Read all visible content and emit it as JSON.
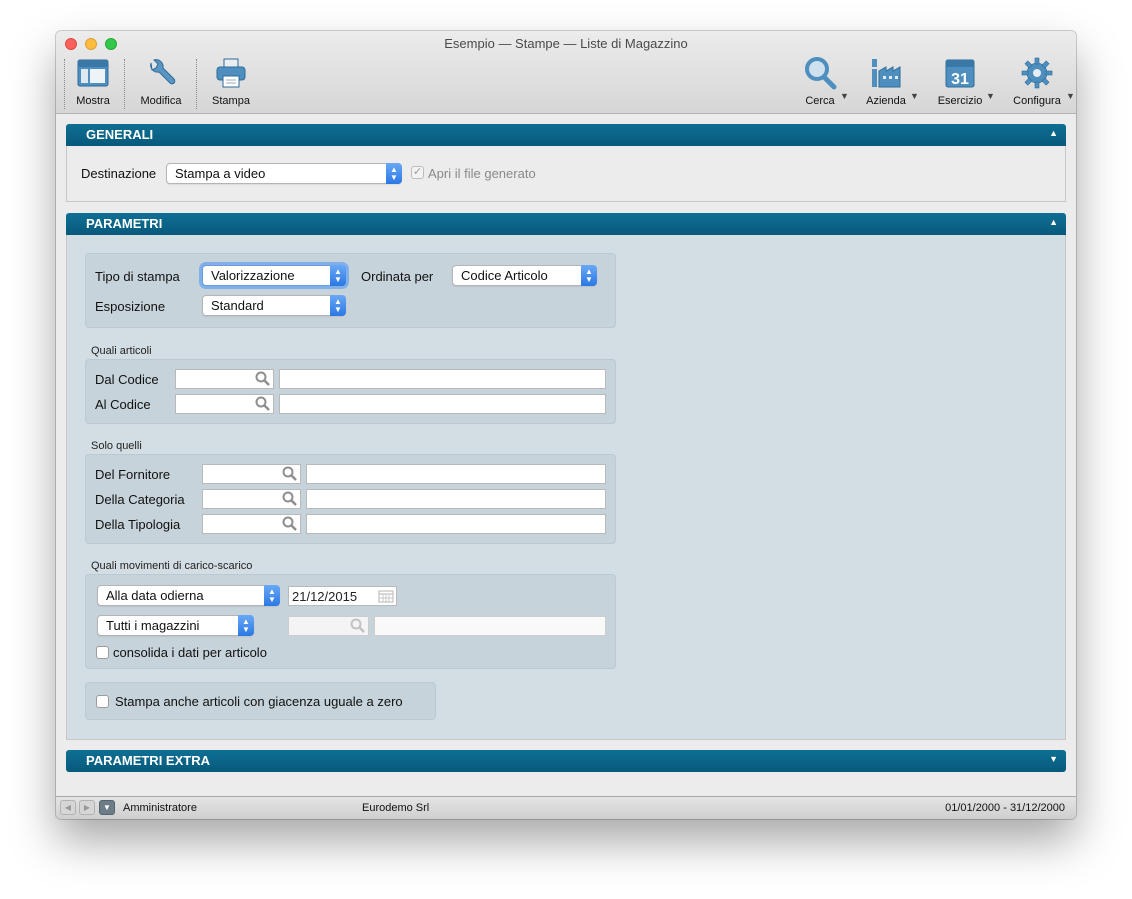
{
  "window": {
    "title": "Esempio — Stampe — Liste di Magazzino"
  },
  "toolbar": {
    "mostra": "Mostra",
    "modifica": "Modifica",
    "stampa": "Stampa",
    "cerca": "Cerca",
    "azienda": "Azienda",
    "esercizio": "Esercizio",
    "esercizio_icon_day": "31",
    "configura": "Configura",
    "icons": [
      "layout-icon",
      "wrench-icon",
      "printer-icon",
      "magnifier-icon",
      "factory-icon",
      "calendar-icon",
      "gear-icon"
    ]
  },
  "generali": {
    "header": "GENERALI",
    "destinazione_label": "Destinazione",
    "destinazione_value": "Stampa a video",
    "apri_file_label": "Apri il file generato",
    "apri_file_checked": true
  },
  "parametri": {
    "header": "PARAMETRI",
    "tipo_stampa_label": "Tipo di stampa",
    "tipo_stampa_value": "Valorizzazione",
    "ordinata_per_label": "Ordinata per",
    "ordinata_per_value": "Codice Articolo",
    "esposizione_label": "Esposizione",
    "esposizione_value": "Standard",
    "quali_articoli": {
      "title": "Quali articoli",
      "dal_codice_label": "Dal Codice",
      "al_codice_label": "Al Codice",
      "dal_codice_value": "",
      "al_codice_value": ""
    },
    "solo_quelli": {
      "title": "Solo quelli",
      "fornitore_label": "Del Fornitore",
      "categoria_label": "Della Categoria",
      "tipologia_label": "Della Tipologia"
    },
    "movimenti": {
      "title": "Quali movimenti di carico-scarico",
      "data_mode": "Alla data odierna",
      "data_value": "21/12/2015",
      "magazzini": "Tutti i magazzini",
      "consolida_label": "consolida i dati per articolo",
      "consolida_checked": false
    },
    "giacenza_zero_label": "Stampa anche articoli con giacenza uguale a zero",
    "giacenza_zero_checked": false
  },
  "parametri_extra": {
    "header": "PARAMETRI EXTRA"
  },
  "status": {
    "user": "Amministratore",
    "company": "Eurodemo Srl",
    "period": "01/01/2000 - 31/12/2000"
  },
  "colors": {
    "section_header": "#0a6489",
    "panel_bg": "#d2dee4",
    "group_bg": "#c6d3da",
    "accent_blue": "#2b78e4"
  }
}
